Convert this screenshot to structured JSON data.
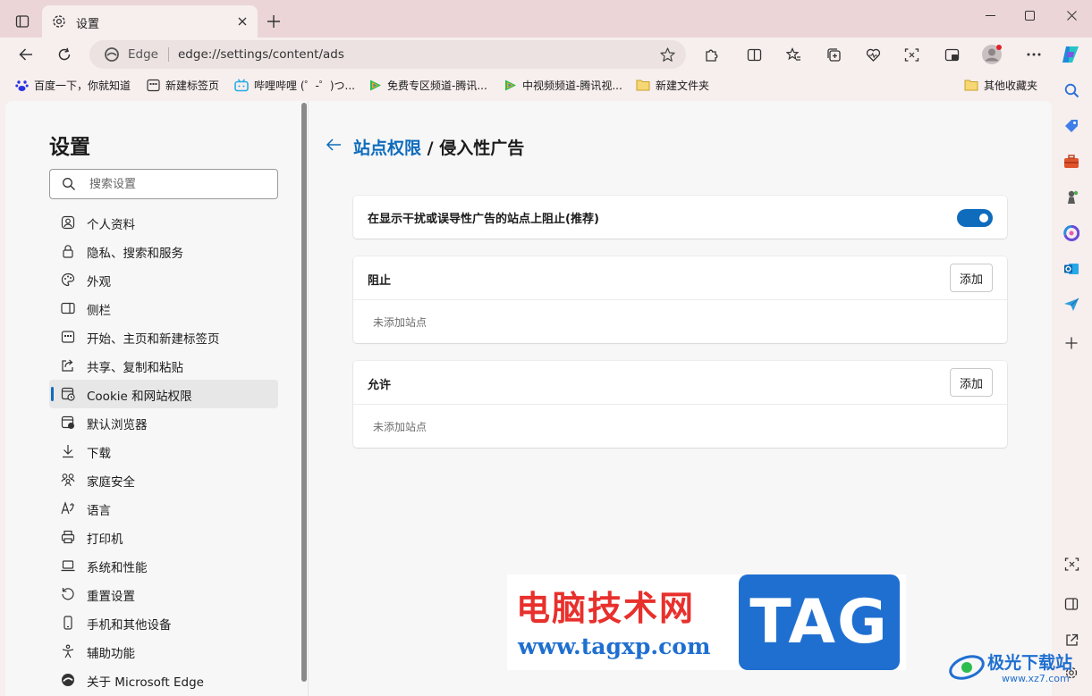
{
  "tab": {
    "title": "设置"
  },
  "address": {
    "label": "Edge",
    "url": "edge://settings/content/ads"
  },
  "bookmarks": [
    "百度一下，你就知道",
    "新建标签页",
    "哔哩哔哩 (゜-゜)つ...",
    "免费专区频道-腾讯...",
    "中视频频道-腾讯视...",
    "新建文件夹"
  ],
  "bookmarks_other": "其他收藏夹",
  "settings": {
    "title": "设置",
    "search_placeholder": "搜索设置",
    "nav": [
      "个人资料",
      "隐私、搜索和服务",
      "外观",
      "侧栏",
      "开始、主页和新建标签页",
      "共享、复制和粘贴",
      "Cookie 和网站权限",
      "默认浏览器",
      "下载",
      "家庭安全",
      "语言",
      "打印机",
      "系统和性能",
      "重置设置",
      "手机和其他设备",
      "辅助功能",
      "关于 Microsoft Edge"
    ],
    "active_index": 6
  },
  "page": {
    "breadcrumb_link": "站点权限",
    "breadcrumb_sep": " / ",
    "breadcrumb_current": "侵入性广告",
    "toggle_label": "在显示干扰或误导性广告的站点上阻止(推荐)",
    "toggle_on": true,
    "block": {
      "title": "阻止",
      "add_label": "添加",
      "empty": "未添加站点"
    },
    "allow": {
      "title": "允许",
      "add_label": "添加",
      "empty": "未添加站点"
    }
  },
  "watermark": {
    "cn": "电脑技术网",
    "url": "www.tagxp.com",
    "tag": "TAG",
    "corner_cn": "极光下载站",
    "corner_url": "www.xz7.com"
  },
  "colors": {
    "accent": "#0f6cbd",
    "titlebar": "#ebd5d6",
    "chrome": "#f7eeee"
  }
}
